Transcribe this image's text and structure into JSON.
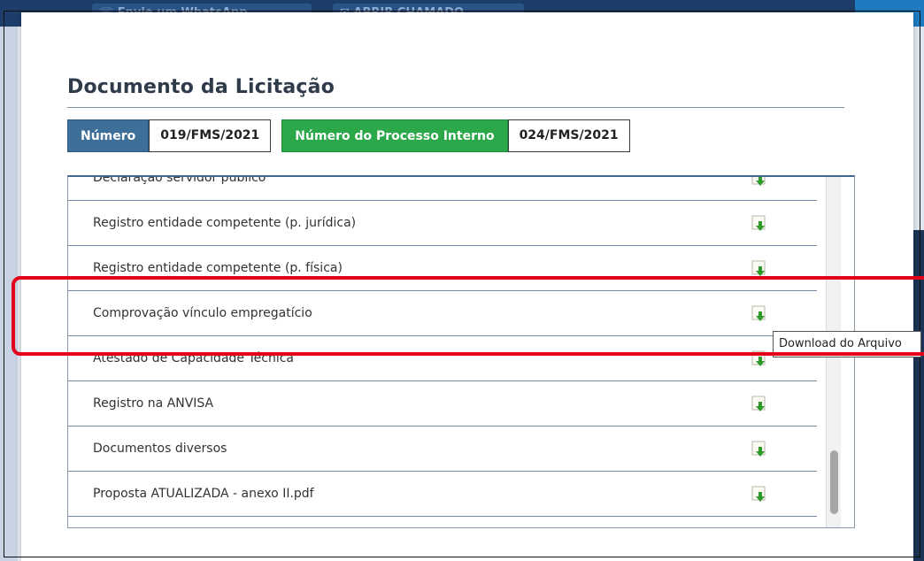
{
  "background": {
    "whatsapp_label": "Envie um WhatsApp",
    "chamado_label": "ABRIR CHAMADO"
  },
  "modal": {
    "title": "Documento da Licitação",
    "numero_label": "Número",
    "numero_value": "019/FMS/2021",
    "processo_label": "Número do Processo Interno",
    "processo_value": "024/FMS/2021"
  },
  "documents": [
    {
      "name": "Declaração servidor público",
      "icon": "download-icon"
    },
    {
      "name": "Registro entidade competente (p. jurídica)",
      "icon": "download-icon"
    },
    {
      "name": "Registro entidade competente (p. física)",
      "icon": "download-icon"
    },
    {
      "name": "Comprovação vínculo empregatício",
      "icon": "download-icon"
    },
    {
      "name": "Atestado de Capacidade Técnica",
      "icon": "download-icon"
    },
    {
      "name": "Registro na ANVISA",
      "icon": "download-icon"
    },
    {
      "name": "Documentos diversos",
      "icon": "download-icon"
    },
    {
      "name": "Proposta ATUALIZADA - anexo II.pdf",
      "icon": "download-icon"
    }
  ],
  "tooltip": "Download do Arquivo",
  "colors": {
    "numero_tag": "#3e6f98",
    "processo_tag": "#2aa84a",
    "highlight": "#e3001b",
    "download_arrow": "#2e9a2a"
  }
}
